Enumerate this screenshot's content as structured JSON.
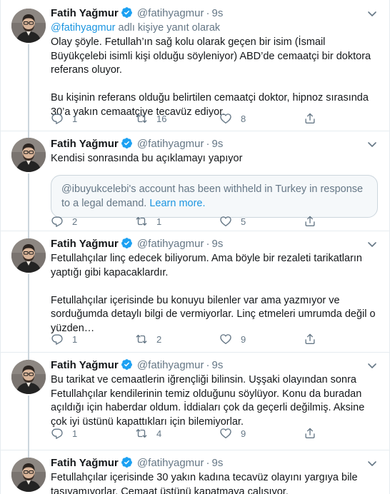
{
  "colors": {
    "accent": "#1da1f2",
    "link": "#1b95e0",
    "secondary_text": "#657786",
    "divider": "#e6ecf0",
    "card_background": "#f5f8fa"
  },
  "icons": {
    "verified": "verified-badge-icon",
    "menu": "chevron-down-icon",
    "reply": "reply-icon",
    "retweet": "retweet-icon",
    "like": "heart-icon",
    "share": "share-icon"
  },
  "tweets": [
    {
      "name": "Fatih Yağmur",
      "handle": "@fatihyagmur",
      "dot": "·",
      "time": "9s",
      "replying_mention": "@fatihyagmur",
      "replying_suffix": " adlı kişiye yanıt olarak",
      "paragraphs": [
        "Olay şöyle. Fetullah’ın sağ kolu olarak geçen bir isim (İsmail Büyükçelebi isimli kişi olduğu söyleniyor) ABD’de cemaatçi bir doktora referans oluyor.",
        "Bu kişinin referans olduğu belirtilen cemaatçi doktor, hipnoz sırasında 30’a yakın cemaatçiye tecavüz ediyor."
      ],
      "replies": "1",
      "retweets": "16",
      "likes": "8"
    },
    {
      "name": "Fatih Yağmur",
      "handle": "@fatihyagmur",
      "dot": "·",
      "time": "9s",
      "paragraphs": [
        "Kendisi sonrasında bu açıklamayı yapıyor"
      ],
      "withheld_text": "@ibuyukcelebi's account has been withheld in Turkey in response to a legal demand.",
      "withheld_link": "Learn more.",
      "replies": "2",
      "retweets": "1",
      "likes": "5"
    },
    {
      "name": "Fatih Yağmur",
      "handle": "@fatihyagmur",
      "dot": "·",
      "time": "9s",
      "paragraphs": [
        "Fetullahçılar linç edecek biliyorum. Ama böyle bir rezaleti tarikatların yaptığı gibi kapacaklardır.",
        "Fetullahçılar içerisinde bu konuyu bilenler var ama yazmıyor ve sorduğumda detaylı bilgi de vermiyorlar. Linç etmeleri umrumda değil o yüzden…"
      ],
      "replies": "1",
      "retweets": "2",
      "likes": "9"
    },
    {
      "name": "Fatih Yağmur",
      "handle": "@fatihyagmur",
      "dot": "·",
      "time": "9s",
      "paragraphs": [
        "Bu tarikat ve cemaatlerin iğrençliği bilinsin. Uşşaki olayından sonra Fetullahçılar kendilerinin temiz olduğunu söylüyor. Konu da buradan açıldığı için haberdar oldum. İddiaları çok da geçerli değilmiş. Aksine çok iyi üstünü kapattıkları için bilemiyorlar."
      ],
      "replies": "1",
      "retweets": "4",
      "likes": "9"
    },
    {
      "name": "Fatih Yağmur",
      "handle": "@fatihyagmur",
      "dot": "·",
      "time": "9s",
      "paragraphs": [
        "Fetullahçılar içerisinde 30 yakın kadına tecavüz olayını yargıya bile taşıyamıyorlar. Cemaat üstünü kapatmaya çalışıyor."
      ]
    }
  ]
}
